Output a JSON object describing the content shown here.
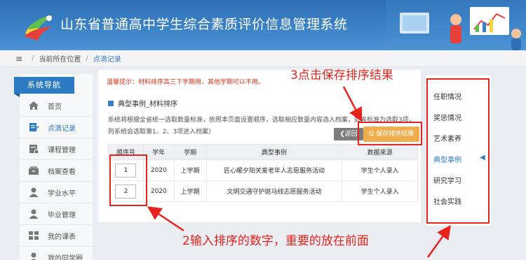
{
  "header": {
    "title": "山东省普通高中学生综合素质评价信息管理系统"
  },
  "breadcrumb": {
    "menu_icon": "menu-icon",
    "location_label": "当前所在位置",
    "current": "点滴记录"
  },
  "sidebar": {
    "heading": "系统导航",
    "items": [
      {
        "label": "首页",
        "icon": "home-icon",
        "active": false
      },
      {
        "label": "点滴记录",
        "icon": "edit-icon",
        "active": true
      },
      {
        "label": "课程管理",
        "icon": "course-icon",
        "active": false
      },
      {
        "label": "档案查看",
        "icon": "archive-icon",
        "active": false
      },
      {
        "label": "学业水平",
        "icon": "user-icon",
        "active": false
      },
      {
        "label": "毕业管理",
        "icon": "user-icon",
        "active": false
      },
      {
        "label": "我的课表",
        "icon": "schedule-icon",
        "active": false
      },
      {
        "label": "我的同学圈",
        "icon": "user-icon",
        "active": false
      }
    ]
  },
  "main": {
    "tip": "温馨提示：材料排序高三下学期用，其他学期可以不用。",
    "section_title": "典型事例_材料排序",
    "description": "系统将根据全省统一选取数量标准，依照本页面设置顺序，选取相应数量内容选入档案，如省标准为选取3项，则系统会选取第1、2、3项进入档案）",
    "back_button": "返回",
    "save_button": "保存排序结果",
    "table": {
      "headers": [
        "顺序号",
        "学年",
        "学期",
        "典型事例",
        "数据来源"
      ],
      "rows": [
        {
          "order": "1",
          "year": "2020",
          "term": "上学期",
          "event": "匠心暖夕阳关爱老年人志愿服务活动",
          "source": "学生个人录入"
        },
        {
          "order": "2",
          "year": "2020",
          "term": "上学期",
          "event": "文明交通守护斑马线志愿服务活动",
          "source": "学生个人录入"
        }
      ]
    }
  },
  "right_panel": {
    "items": [
      {
        "label": "任职情况",
        "active": false
      },
      {
        "label": "奖惩情况",
        "active": false
      },
      {
        "label": "艺术素养",
        "active": false
      },
      {
        "label": "典型事例",
        "active": true
      },
      {
        "label": "研究学习",
        "active": false
      },
      {
        "label": "社会实践",
        "active": false
      }
    ]
  },
  "annotations": {
    "step3": "3点击保存排序结果",
    "step2": "2输入排序的数字，重要的放在前面"
  },
  "colors": {
    "header_blue": "#3b82c7",
    "accent_blue": "#2d7cc3",
    "save_orange": "#f0ad4e",
    "annotation_red": "#e8231b",
    "tip_red": "#d9341c"
  }
}
